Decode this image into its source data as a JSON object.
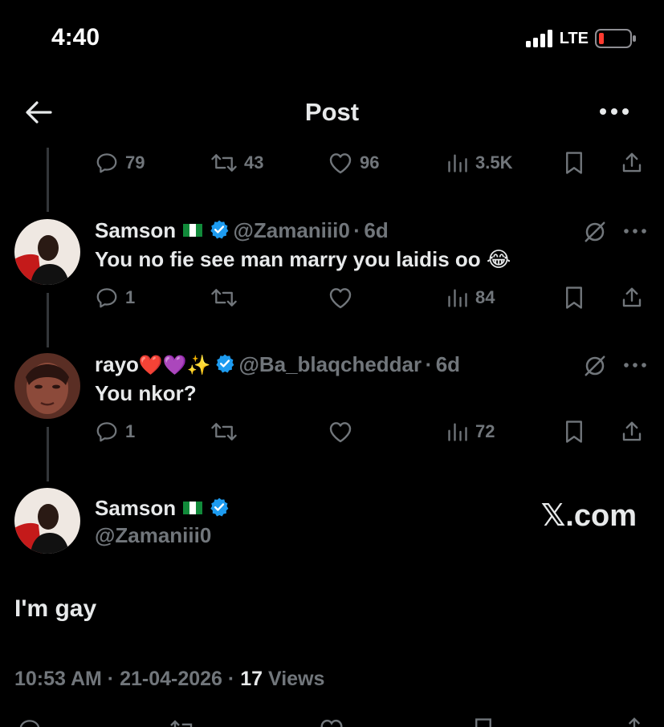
{
  "status_bar": {
    "time": "4:40",
    "network": "LTE"
  },
  "header": {
    "title": "Post"
  },
  "parent_stats": {
    "replies": "79",
    "reposts": "43",
    "likes": "96",
    "views": "3.5K"
  },
  "replies": [
    {
      "name": "Samson",
      "handle": "@Zamaniii0",
      "age": "6d",
      "text": "You no fie see man marry you laidis oo 😂",
      "reply_count": "1",
      "repost_count": "",
      "like_count": "",
      "view_count": "84"
    },
    {
      "name": "rayo",
      "name_emoji": "❤️💜✨",
      "handle": "@Ba_blaqcheddar",
      "age": "6d",
      "text": "You nkor?",
      "reply_count": "1",
      "repost_count": "",
      "like_count": "",
      "view_count": "72"
    }
  ],
  "main_post": {
    "name": "Samson",
    "handle": "@Zamaniii0",
    "text": "I'm gay",
    "time": "10:53 AM",
    "date": "21-04-2026",
    "views_count": "17",
    "views_label": "Views"
  },
  "watermark": "𝕏.com",
  "separator": "·",
  "colors": {
    "verified": "#1d9bf0",
    "muted": "#71767b",
    "text": "#e7e9ea",
    "battery": "#ff3b30"
  }
}
